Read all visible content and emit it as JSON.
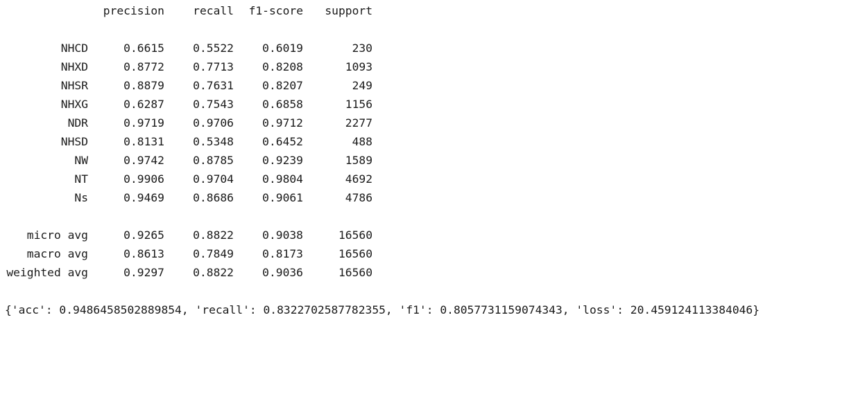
{
  "report": {
    "headers": [
      "precision",
      "recall",
      "f1-score",
      "support"
    ],
    "class_rows": [
      {
        "label": "NHCD",
        "precision": "0.6615",
        "recall": "0.5522",
        "f1": "0.6019",
        "support": "230"
      },
      {
        "label": "NHXD",
        "precision": "0.8772",
        "recall": "0.7713",
        "f1": "0.8208",
        "support": "1093"
      },
      {
        "label": "NHSR",
        "precision": "0.8879",
        "recall": "0.7631",
        "f1": "0.8207",
        "support": "249"
      },
      {
        "label": "NHXG",
        "precision": "0.6287",
        "recall": "0.7543",
        "f1": "0.6858",
        "support": "1156"
      },
      {
        "label": "NDR",
        "precision": "0.9719",
        "recall": "0.9706",
        "f1": "0.9712",
        "support": "2277"
      },
      {
        "label": "NHSD",
        "precision": "0.8131",
        "recall": "0.5348",
        "f1": "0.6452",
        "support": "488"
      },
      {
        "label": "NW",
        "precision": "0.9742",
        "recall": "0.8785",
        "f1": "0.9239",
        "support": "1589"
      },
      {
        "label": "NT",
        "precision": "0.9906",
        "recall": "0.9704",
        "f1": "0.9804",
        "support": "4692"
      },
      {
        "label": "Ns",
        "precision": "0.9469",
        "recall": "0.8686",
        "f1": "0.9061",
        "support": "4786"
      }
    ],
    "avg_rows": [
      {
        "label": "micro avg",
        "precision": "0.9265",
        "recall": "0.8822",
        "f1": "0.9038",
        "support": "16560"
      },
      {
        "label": "macro avg",
        "precision": "0.8613",
        "recall": "0.7849",
        "f1": "0.8173",
        "support": "16560"
      },
      {
        "label": "weighted avg",
        "precision": "0.9297",
        "recall": "0.8822",
        "f1": "0.9036",
        "support": "16560"
      }
    ]
  },
  "result_dict": "{'acc': 0.9486458502889854, 'recall': 0.8322702587782355, 'f1': 0.8057731159074343, 'loss': 20.459124113384046}"
}
